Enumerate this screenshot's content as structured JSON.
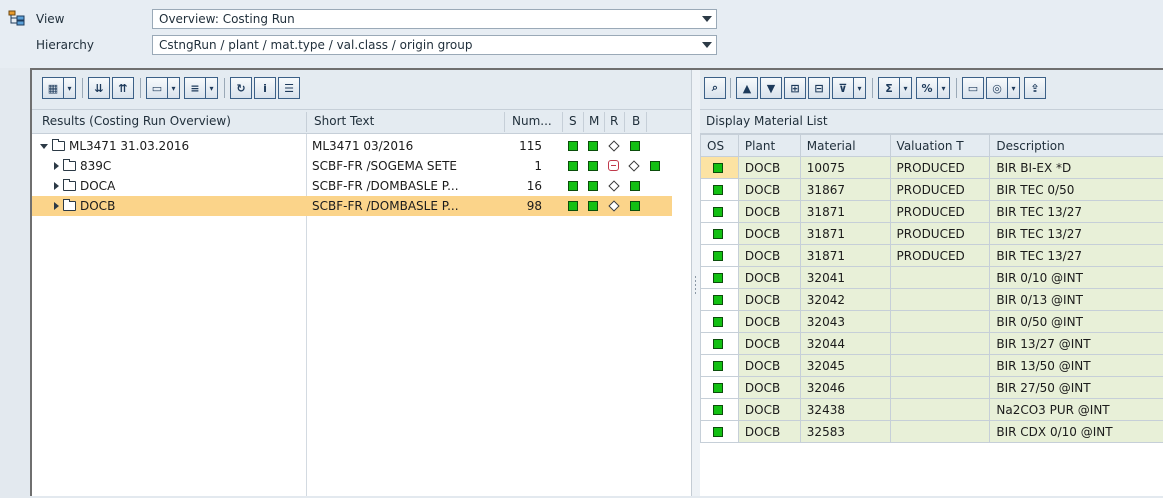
{
  "selectors": {
    "view_label": "View",
    "view_value": "Overview: Costing Run",
    "hierarchy_label": "Hierarchy",
    "hierarchy_value": "CstngRun / plant / mat.type / val.class / origin group"
  },
  "tree": {
    "headers": {
      "results": "Results (Costing Run Overview)",
      "short_text": "Short Text",
      "num": "Num...",
      "s": "S",
      "m": "M",
      "r": "R",
      "b": "B"
    },
    "rows": [
      {
        "name": "ML3471   31.03.2016",
        "short_text": "ML3471 03/2016",
        "num": "115"
      },
      {
        "name": "839C",
        "short_text": "SCBF-FR  /SOGEMA SETE",
        "num": "1"
      },
      {
        "name": "DOCA",
        "short_text": "SCBF-FR  /DOMBASLE P...",
        "num": "16"
      },
      {
        "name": "DOCB",
        "short_text": "SCBF-FR  /DOMBASLE P...",
        "num": "98"
      }
    ]
  },
  "material_list": {
    "title": "Display Material List",
    "headers": {
      "os": "OS",
      "plant": "Plant",
      "material": "Material",
      "valuation": "Valuation T",
      "description": "Description"
    },
    "rows": [
      {
        "plant": "DOCB",
        "material": "10075",
        "valuation": "PRODUCED",
        "description": "BIR BI-EX *D"
      },
      {
        "plant": "DOCB",
        "material": "31867",
        "valuation": "PRODUCED",
        "description": "BIR TEC 0/50"
      },
      {
        "plant": "DOCB",
        "material": "31871",
        "valuation": "PRODUCED",
        "description": "BIR TEC 13/27"
      },
      {
        "plant": "DOCB",
        "material": "31871",
        "valuation": "PRODUCED",
        "description": "BIR TEC 13/27"
      },
      {
        "plant": "DOCB",
        "material": "31871",
        "valuation": "PRODUCED",
        "description": "BIR TEC 13/27"
      },
      {
        "plant": "DOCB",
        "material": "32041",
        "valuation": "",
        "description": "BIR 0/10 @INT"
      },
      {
        "plant": "DOCB",
        "material": "32042",
        "valuation": "",
        "description": "BIR 0/13 @INT"
      },
      {
        "plant": "DOCB",
        "material": "32043",
        "valuation": "",
        "description": "BIR 0/50 @INT"
      },
      {
        "plant": "DOCB",
        "material": "32044",
        "valuation": "",
        "description": "BIR 13/27 @INT"
      },
      {
        "plant": "DOCB",
        "material": "32045",
        "valuation": "",
        "description": "BIR 13/50 @INT"
      },
      {
        "plant": "DOCB",
        "material": "32046",
        "valuation": "",
        "description": "BIR 27/50 @INT"
      },
      {
        "plant": "DOCB",
        "material": "32438",
        "valuation": "",
        "description": "Na2CO3 PUR @INT"
      },
      {
        "plant": "DOCB",
        "material": "32583",
        "valuation": "",
        "description": "BIR CDX 0/10 @INT"
      }
    ]
  },
  "colors": {
    "status_green": "#13c013",
    "selected_row": "#fbd48a",
    "grid_cell": "#e8f0d8"
  }
}
